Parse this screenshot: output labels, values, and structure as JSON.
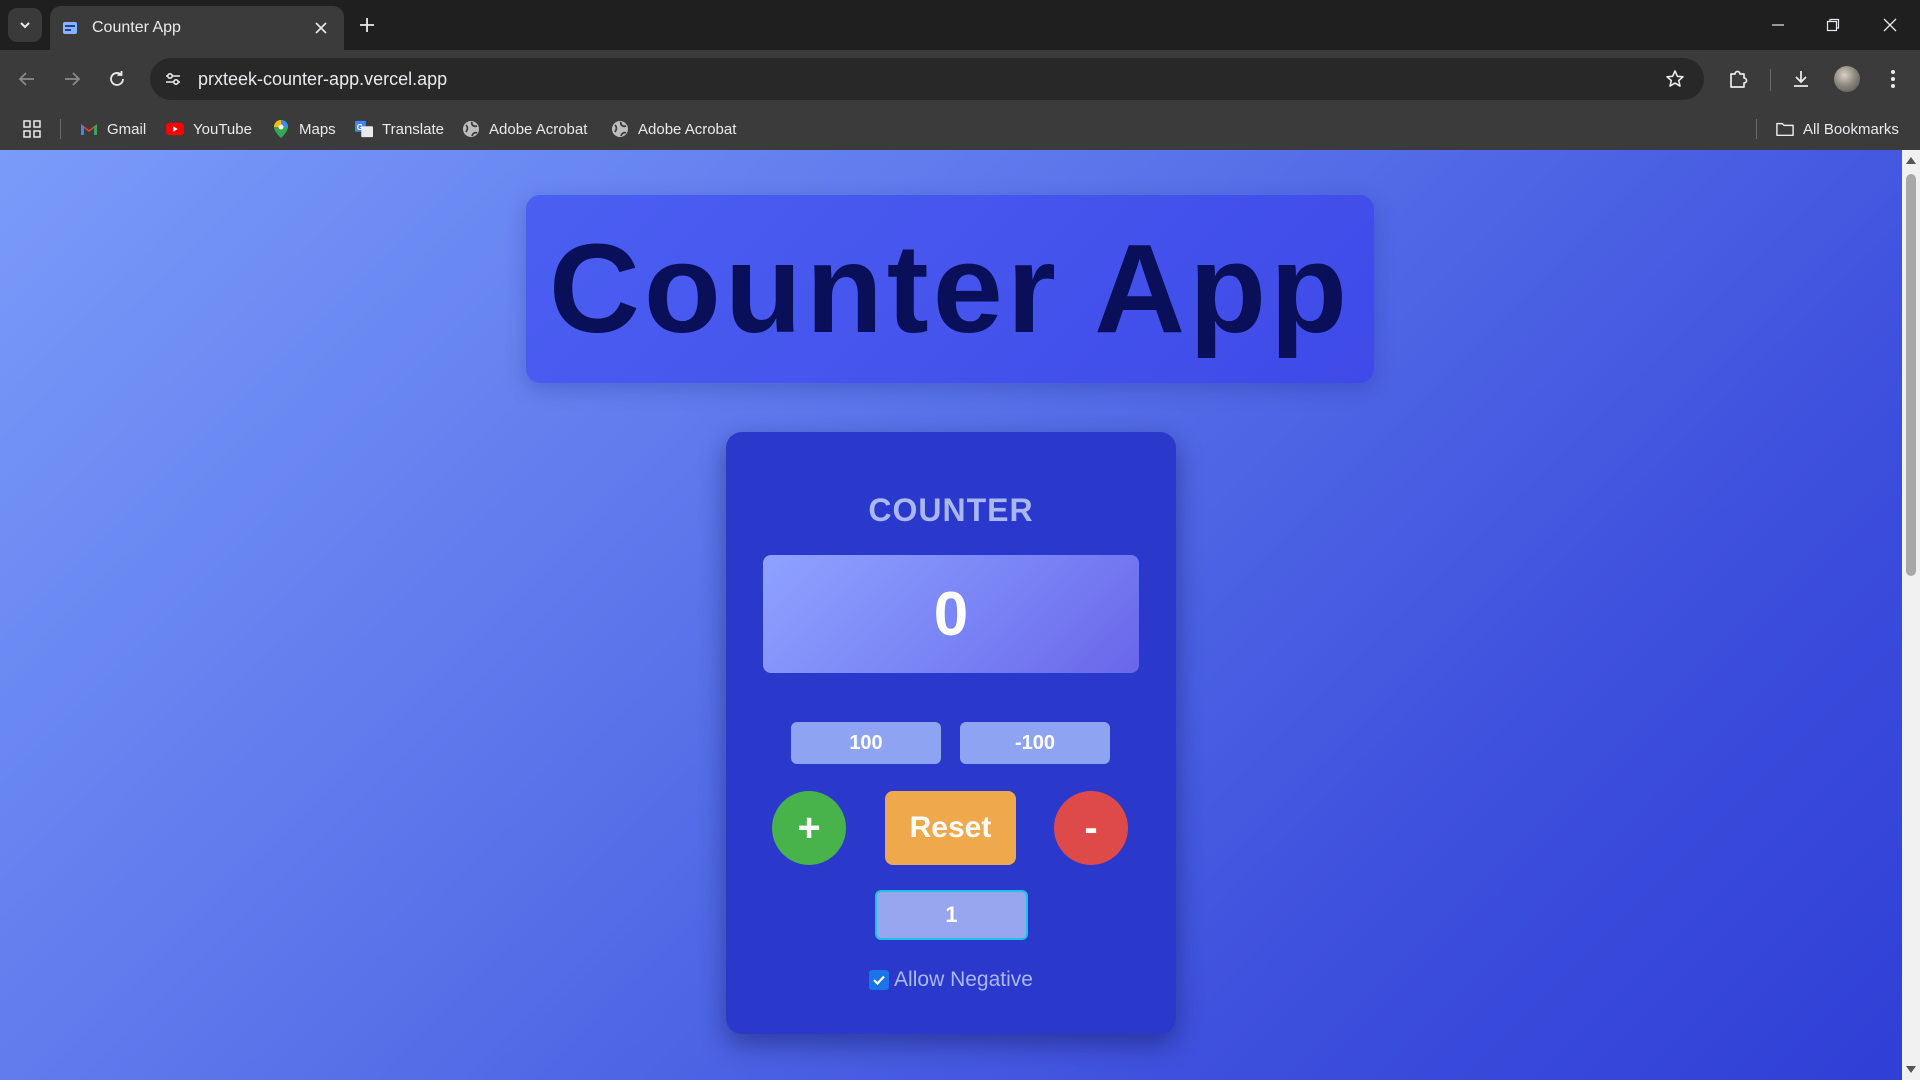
{
  "browser": {
    "tab_title": "Counter App",
    "url": "prxteek-counter-app.vercel.app",
    "bookmarks": [
      {
        "label": "Gmail",
        "icon": "gmail-icon"
      },
      {
        "label": "YouTube",
        "icon": "youtube-icon"
      },
      {
        "label": "Maps",
        "icon": "maps-icon"
      },
      {
        "label": "Translate",
        "icon": "translate-icon"
      },
      {
        "label": "Adobe Acrobat",
        "icon": "globe-icon"
      },
      {
        "label": "Adobe Acrobat",
        "icon": "globe-icon"
      }
    ],
    "all_bookmarks_label": "All Bookmarks"
  },
  "app": {
    "title": "Counter App",
    "counter_label": "COUNTER",
    "count_value": "0",
    "preset_plus_label": "100",
    "preset_minus_label": "-100",
    "increment_label": "+",
    "reset_label": "Reset",
    "decrement_label": "-",
    "step_value": "1",
    "allow_negative_label": "Allow Negative",
    "allow_negative_checked": true
  },
  "colors": {
    "increment": "#47b34a",
    "reset": "#f0a84c",
    "decrement": "#de4a4a",
    "card": "#2b38cc",
    "title_text": "#0a0f5a"
  }
}
